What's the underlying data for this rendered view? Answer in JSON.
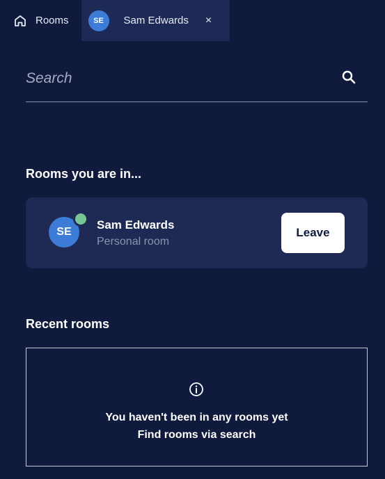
{
  "tabs": {
    "home": {
      "label": "Rooms",
      "icon": "home-icon"
    },
    "active": {
      "avatar_initials": "SE",
      "label": "Sam Edwards",
      "close_glyph": "×",
      "icon": "close-icon"
    }
  },
  "search": {
    "placeholder": "Search",
    "value": "",
    "icon": "search-icon"
  },
  "rooms_in": {
    "title": "Rooms you are in...",
    "items": [
      {
        "avatar_initials": "SE",
        "name": "Sam Edwards",
        "subtitle": "Personal room",
        "presence": "online",
        "action_label": "Leave"
      }
    ]
  },
  "recent": {
    "title": "Recent rooms",
    "empty_icon": "info-icon",
    "empty_line1": "You haven't been in any rooms yet",
    "empty_line2": "Find rooms via search"
  },
  "colors": {
    "background": "#0f1a3d",
    "card": "#1e2a54",
    "avatar": "#3c7bd6",
    "presence": "#79c596"
  }
}
